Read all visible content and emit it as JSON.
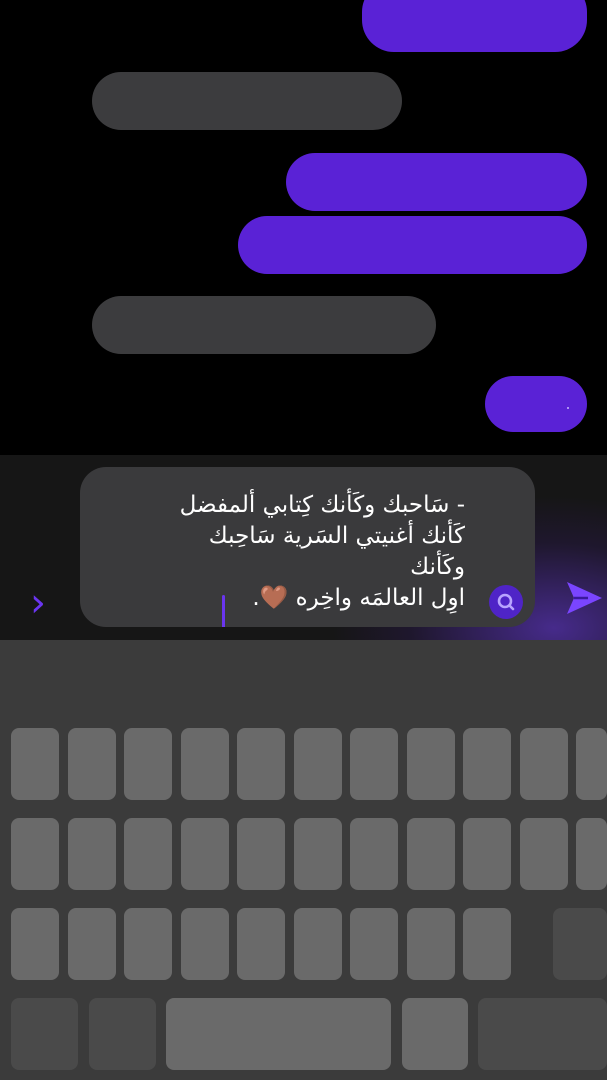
{
  "compose": {
    "lines": [
      "- سَاحبك وكَأنك كِتابي ألمفضل",
      "كَأنك أغنيتي السَرية سَاحِبك",
      "وكَأنك",
      "اوِل العالمَه واخِره 🤎."
    ]
  },
  "icons": {
    "expand": "chevron-right-icon",
    "search": "search-icon",
    "send": "send-icon"
  },
  "colors": {
    "outgoing_bubble": "#5a22d6",
    "incoming_bubble": "#3c3c3e",
    "accent": "#6a35f0",
    "keyboard_bg": "#3b3b3b",
    "key": "#6a6a6a"
  }
}
